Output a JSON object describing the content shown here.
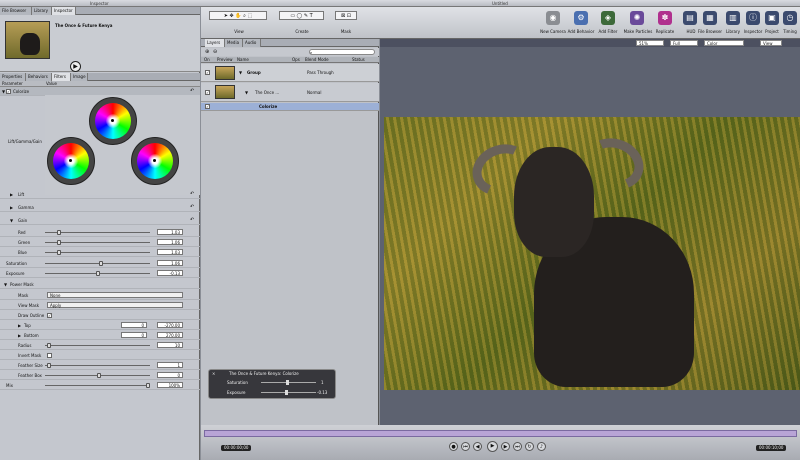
{
  "app": {
    "left_title": "Inspector",
    "main_title": "Untitled"
  },
  "top_tabs": [
    "File Browser",
    "Library",
    "Inspector"
  ],
  "preview": {
    "title": "The Once & Future Kenya"
  },
  "inspector_tabs": [
    "Properties",
    "Behaviors",
    "Filters",
    "Image"
  ],
  "columns": {
    "parameter": "Parameter",
    "value": "Value"
  },
  "params": {
    "colorize": "Colorize",
    "lgg": "Lift/Gamma/Gain",
    "lift": "Lift",
    "gamma": "Gamma",
    "gain": "Gain",
    "red": "Red",
    "red_val": "1.03",
    "green": "Green",
    "green_val": "1.06",
    "blue": "Blue",
    "blue_val": "1.03",
    "saturation": "Saturation",
    "saturation_val": "1.06",
    "exposure": "Exposure",
    "exposure_val": "-0.13",
    "powermask": "Power Mask",
    "mask": "Mask",
    "mask_val": "None",
    "viewmask": "View Mask",
    "viewmask_val": "Apply",
    "drawoutline": "Draw Outline",
    "top": "Top",
    "top_a": "0",
    "top_b": "-270.00",
    "bottom": "Bottom",
    "bottom_a": "0",
    "bottom_b": "270.00",
    "radius": "Radius",
    "radius_val": "10",
    "invertmask": "Invert Mask",
    "feathersize": "Feather Size",
    "feathersize_val": "1",
    "featherbox": "Feather Box",
    "featherbox_val": "0",
    "mix": "Mix",
    "mix_val": "100%"
  },
  "toolbar": {
    "view": "View",
    "create": "Create",
    "mask": "Mask",
    "new_camera": "New Camera",
    "add_behavior": "Add Behavior",
    "add_filter": "Add Filter",
    "make_particles": "Make Particles",
    "replicate": "Replicate",
    "hud": "HUD",
    "file_browser": "File Browser",
    "library": "Library",
    "inspector": "Inspector",
    "project": "Project",
    "timing": "Timing",
    "zoom": "51%",
    "render": "Full",
    "channels": "Color",
    "view_dd": "View"
  },
  "layers": {
    "tabs": [
      "Layers",
      "Media",
      "Audio"
    ],
    "cols": {
      "on": "On",
      "preview": "Preview",
      "name": "Name",
      "ops": "Ops",
      "blend": "Blend Mode",
      "status": "Status"
    },
    "rows": [
      {
        "name": "Group",
        "blend": "Pass Through"
      },
      {
        "name": "The Once ...",
        "blend": "Normal"
      },
      {
        "name": "Colorize",
        "blend": ""
      }
    ]
  },
  "hud": {
    "title": "The Once & Future Kenya: Colorize",
    "sat": "Saturation",
    "sat_val": "1",
    "exp": "Exposure",
    "exp_val": "-0.13"
  },
  "timeline": {
    "start": "00:00:00;00",
    "end": "00:00:10;00"
  }
}
